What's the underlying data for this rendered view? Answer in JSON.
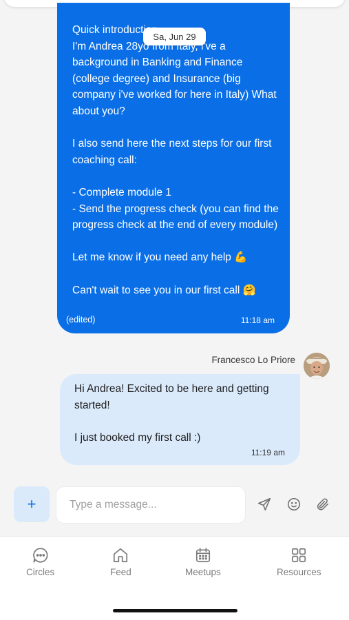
{
  "chat": {
    "date_label": "Sa, Jun 29",
    "incoming": {
      "text": "Quick introduction\nI'm Andrea 28yo from Italy, i've a background in Banking and Finance (college degree) and Insurance (big company i've worked for here in Italy) What about you?\n\nI also send here the next steps for our first coaching call:\n\n- Complete module 1\n- Send the progress check (you can find the progress check at the end of every module)\n\nLet me know if you need any help 💪\n\nCan't wait to see you in our first call 🤗",
      "edited_label": "(edited)",
      "time": "11:18 am"
    },
    "outgoing": {
      "sender": "Francesco Lo Priore",
      "text": "Hi Andrea! Excited to be here and getting started!\n\nI just booked my first call :)",
      "time": "11:19 am"
    }
  },
  "composer": {
    "add_label": "+",
    "placeholder": "Type a message..."
  },
  "tabs": [
    {
      "label": "Circles",
      "icon": "chat-bubble-icon"
    },
    {
      "label": "Feed",
      "icon": "home-icon"
    },
    {
      "label": "Meetups",
      "icon": "calendar-icon"
    },
    {
      "label": "Resources",
      "icon": "grid-icon"
    }
  ],
  "colors": {
    "accent": "#0a6fe6",
    "outgoing_bubble": "#dbeafb",
    "background": "#f4f4f4"
  }
}
